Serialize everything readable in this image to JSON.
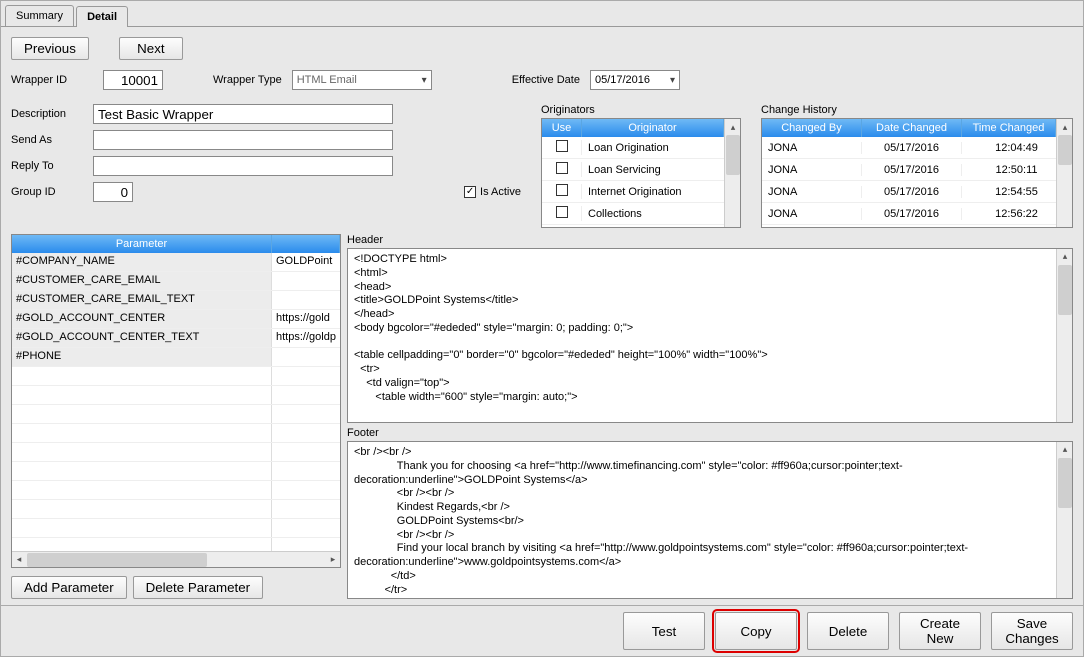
{
  "tabs": {
    "summary": "Summary",
    "detail": "Detail"
  },
  "nav": {
    "previous": "Previous",
    "next": "Next"
  },
  "labels": {
    "wrapper_id": "Wrapper ID",
    "wrapper_type": "Wrapper Type",
    "effective_date": "Effective Date",
    "description": "Description",
    "send_as": "Send As",
    "reply_to": "Reply To",
    "group_id": "Group ID",
    "is_active": "Is Active",
    "originators": "Originators",
    "use": "Use",
    "originator": "Originator",
    "change_history": "Change History",
    "changed_by": "Changed By",
    "date_changed": "Date Changed",
    "time_changed": "Time Changed",
    "parameter": "Parameter",
    "header": "Header",
    "footer": "Footer"
  },
  "fields": {
    "wrapper_id": "10001",
    "wrapper_type": "HTML Email",
    "effective_date": "05/17/2016",
    "description": "Test Basic Wrapper",
    "send_as": "",
    "reply_to": "",
    "group_id": "0",
    "is_active": true
  },
  "originators": [
    {
      "use": false,
      "name": "Loan Origination"
    },
    {
      "use": false,
      "name": "Loan Servicing"
    },
    {
      "use": false,
      "name": "Internet Origination"
    },
    {
      "use": false,
      "name": "Collections"
    }
  ],
  "change_history": [
    {
      "by": "JONA",
      "date": "05/17/2016",
      "time": "12:04:49"
    },
    {
      "by": "JONA",
      "date": "05/17/2016",
      "time": "12:50:11"
    },
    {
      "by": "JONA",
      "date": "05/17/2016",
      "time": "12:54:55"
    },
    {
      "by": "JONA",
      "date": "05/17/2016",
      "time": "12:56:22"
    }
  ],
  "parameters": [
    {
      "name": "#COMPANY_NAME",
      "value": "GOLDPoint"
    },
    {
      "name": "#CUSTOMER_CARE_EMAIL",
      "value": ""
    },
    {
      "name": "#CUSTOMER_CARE_EMAIL_TEXT",
      "value": ""
    },
    {
      "name": "#GOLD_ACCOUNT_CENTER",
      "value": "https://gold"
    },
    {
      "name": "#GOLD_ACCOUNT_CENTER_TEXT",
      "value": "https://goldp"
    },
    {
      "name": "#PHONE",
      "value": ""
    }
  ],
  "header_text": "<!DOCTYPE html>\n<html>\n<head>\n<title>GOLDPoint Systems</title>\n</head>\n<body bgcolor=\"#ededed\" style=\"margin: 0; padding: 0;\">\n\n<table cellpadding=\"0\" border=\"0\" bgcolor=\"#ededed\" height=\"100%\" width=\"100%\">\n  <tr>\n    <td valign=\"top\">\n       <table width=\"600\" style=\"margin: auto;\">",
  "footer_text": "<br /><br />\n              Thank you for choosing <a href=\"http://www.timefinancing.com\" style=\"color: #ff960a;cursor:pointer;text-decoration:underline\">GOLDPoint Systems</a>\n              <br /><br />\n              Kindest Regards,<br />\n              GOLDPoint Systems<br/>\n              <br /><br />\n              Find your local branch by visiting <a href=\"http://www.goldpointsystems.com\" style=\"color: #ff960a;cursor:pointer;text-decoration:underline\">www.goldpointsystems.com</a>\n            </td>\n          </tr>",
  "buttons": {
    "add_param": "Add Parameter",
    "del_param": "Delete Parameter",
    "test": "Test",
    "copy": "Copy",
    "delete": "Delete",
    "create_new": "Create New",
    "save_changes": "Save Changes"
  }
}
